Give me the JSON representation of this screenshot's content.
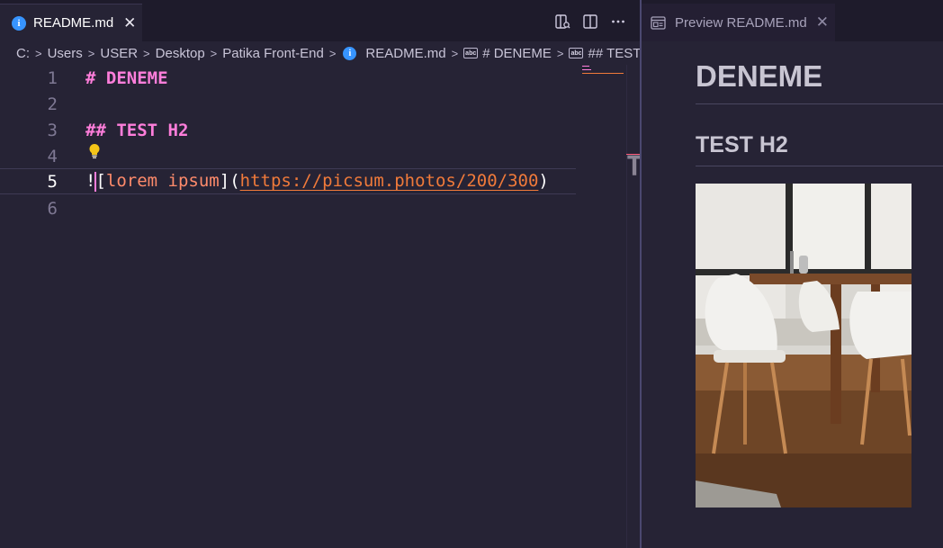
{
  "editor": {
    "tab": {
      "label": "README.md",
      "icon": "info-icon",
      "close_glyph": "✕"
    },
    "actions": [
      {
        "name": "open-preview-side-icon"
      },
      {
        "name": "split-editor-icon"
      },
      {
        "name": "more-actions-icon"
      }
    ],
    "breadcrumb": [
      "C:",
      "Users",
      "USER",
      "Desktop",
      "Patika Front-End",
      "README.md",
      "# DENEME",
      "## TEST H"
    ],
    "lines": [
      {
        "number": "1",
        "text": "# DENEME"
      },
      {
        "number": "2",
        "text": ""
      },
      {
        "number": "3",
        "text": "## TEST H2"
      },
      {
        "number": "4",
        "text": ""
      },
      {
        "number": "5",
        "bang": "!",
        "lbracket": "[",
        "alt": "lorem ipsum",
        "rbracket": "]",
        "lparen": "(",
        "url": "https://picsum.photos/200/300",
        "rparen": ")"
      },
      {
        "number": "6",
        "text": ""
      }
    ],
    "active_line": "5",
    "overflow_glyph": "T"
  },
  "preview": {
    "tab": {
      "label": "Preview README.md",
      "close_glyph": "✕"
    },
    "h1": "DENEME",
    "h2": "TEST H2",
    "image_alt": "lorem ipsum"
  },
  "colors": {
    "background": "#262335",
    "tabbar": "#1e1b2b",
    "heading": "#ff7edb",
    "url": "#f07a3a",
    "alt_text": "#ff8b6b",
    "info_icon": "#3794ff"
  }
}
